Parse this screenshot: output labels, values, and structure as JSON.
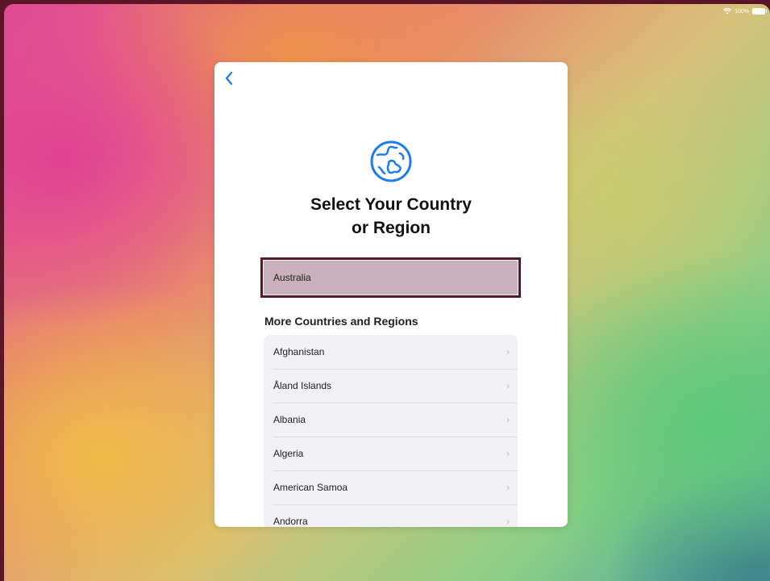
{
  "status_bar": {
    "battery": "100%"
  },
  "header": {
    "back_label": "Back",
    "title_line1": "Select Your Country",
    "title_line2": "or Region"
  },
  "suggested": {
    "label": "Australia"
  },
  "more_section": {
    "heading": "More Countries and Regions",
    "items": [
      "Afghanistan",
      "Åland Islands",
      "Albania",
      "Algeria",
      "American Samoa",
      "Andorra"
    ]
  },
  "colors": {
    "accent": "#1a7cf0",
    "selection_outline": "#5e1624",
    "selected_fill": "#c9b0ba"
  },
  "icons": {
    "back": "chevron-left-icon",
    "globe": "globe-icon",
    "row_chevron": "chevron-right-icon"
  }
}
